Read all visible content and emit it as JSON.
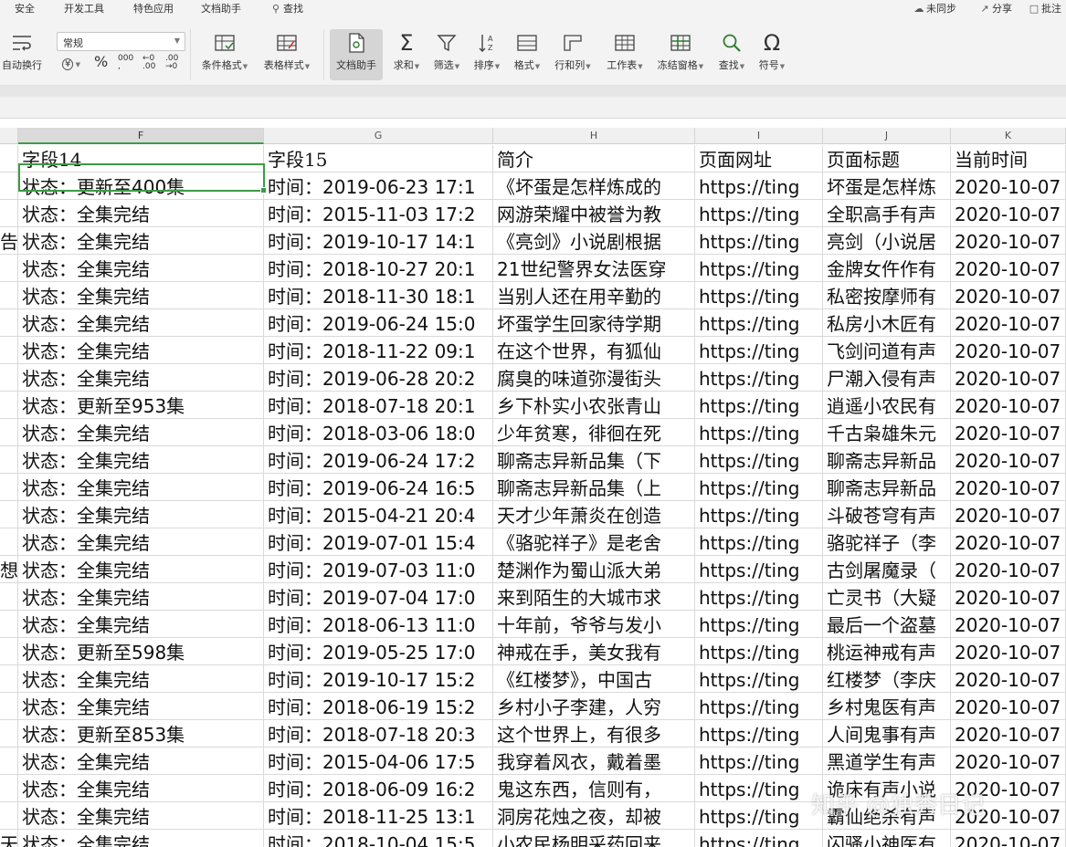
{
  "menu": {
    "left": [
      "安全",
      "开发工具",
      "特色应用",
      "文档助手"
    ],
    "search": "查找",
    "right": [
      "未同步",
      "分享",
      "批注"
    ]
  },
  "ribbon": {
    "wrap_label": "自动换行",
    "format_value": "常规",
    "currency_symbol": "¥",
    "percent_symbol": "%",
    "thousands_symbol": "000",
    "inc_decimal": "←0 .00",
    "dec_decimal": ".00 →0",
    "buttons": [
      {
        "label": "条件格式",
        "icon": "conditional-format-icon"
      },
      {
        "label": "表格样式",
        "icon": "table-style-icon"
      },
      {
        "label": "文档助手",
        "icon": "doc-assistant-icon"
      },
      {
        "label": "求和",
        "icon": "sum-icon"
      },
      {
        "label": "筛选",
        "icon": "filter-icon"
      },
      {
        "label": "排序",
        "icon": "sort-icon"
      },
      {
        "label": "格式",
        "icon": "format-icon"
      },
      {
        "label": "行和列",
        "icon": "rows-cols-icon"
      },
      {
        "label": "工作表",
        "icon": "worksheet-icon"
      },
      {
        "label": "冻结窗格",
        "icon": "freeze-panes-icon"
      },
      {
        "label": "查找",
        "icon": "find-icon"
      },
      {
        "label": "符号",
        "icon": "symbol-icon"
      }
    ]
  },
  "columns": {
    "letters": [
      "F",
      "G",
      "H",
      "I",
      "J",
      "K"
    ],
    "selected": "F"
  },
  "header_row": [
    "",
    "字段14",
    "字段15",
    "简介",
    "页面网址",
    "页面标题",
    "当前时间"
  ],
  "rows": [
    [
      "",
      "状态：更新至400集",
      "时间：2019-06-23 17:1",
      "《坏蛋是怎样炼成的",
      "https://ting",
      "坏蛋是怎样炼",
      "2020-10-07"
    ],
    [
      "",
      "状态：全集完结",
      "时间：2015-11-03 17:2",
      "网游荣耀中被誉为教",
      "https://ting",
      "全职高手有声",
      "2020-10-07"
    ],
    [
      "告",
      "状态：全集完结",
      "时间：2019-10-17 14:1",
      "《亮剑》小说剧根据",
      "https://ting",
      "亮剑（小说居",
      "2020-10-07"
    ],
    [
      "",
      "状态：全集完结",
      "时间：2018-10-27 20:1",
      "21世纪警界女法医穿",
      "https://ting",
      "金牌女仵作有",
      "2020-10-07"
    ],
    [
      "",
      "状态：全集完结",
      "时间：2018-11-30 18:1",
      "当别人还在用辛勤的",
      "https://ting",
      "私密按摩师有",
      "2020-10-07"
    ],
    [
      "",
      "状态：全集完结",
      "时间：2019-06-24 15:0",
      "坏蛋学生回家待学期",
      "https://ting",
      "私房小木匠有",
      "2020-10-07"
    ],
    [
      "",
      "状态：全集完结",
      "时间：2018-11-22 09:1",
      "在这个世界，有狐仙",
      "https://ting",
      "飞剑问道有声",
      "2020-10-07"
    ],
    [
      "",
      "状态：全集完结",
      "时间：2019-06-28 20:2",
      "腐臭的味道弥漫街头",
      "https://ting",
      "尸潮入侵有声",
      "2020-10-07"
    ],
    [
      "",
      "状态：更新至953集",
      "时间：2018-07-18 20:1",
      "乡下朴实小农张青山",
      "https://ting",
      "逍遥小农民有",
      "2020-10-07"
    ],
    [
      "",
      "状态：全集完结",
      "时间：2018-03-06 18:0",
      "少年贫寒，徘徊在死",
      "https://ting",
      "千古枭雄朱元",
      "2020-10-07"
    ],
    [
      "",
      "状态：全集完结",
      "时间：2019-06-24 17:2",
      "聊斋志异新品集（下",
      "https://ting",
      "聊斋志异新品",
      "2020-10-07"
    ],
    [
      "",
      "状态：全集完结",
      "时间：2019-06-24 16:5",
      "聊斋志异新品集（上",
      "https://ting",
      "聊斋志异新品",
      "2020-10-07"
    ],
    [
      "",
      "状态：全集完结",
      "时间：2015-04-21 20:4",
      "天才少年萧炎在创造",
      "https://ting",
      "斗破苍穹有声",
      "2020-10-07"
    ],
    [
      "",
      "状态：全集完结",
      "时间：2019-07-01 15:4",
      "《骆驼祥子》是老舍",
      "https://ting",
      "骆驼祥子（李",
      "2020-10-07"
    ],
    [
      "想",
      "状态：全集完结",
      "时间：2019-07-03 11:0",
      "楚渊作为蜀山派大弟",
      "https://ting",
      "古剑屠魔录（",
      "2020-10-07"
    ],
    [
      "",
      "状态：全集完结",
      "时间：2019-07-04 17:0",
      "来到陌生的大城市求",
      "https://ting",
      "亡灵书（大疑",
      "2020-10-07"
    ],
    [
      "",
      "状态：全集完结",
      "时间：2018-06-13 11:0",
      "十年前，爷爷与发小",
      "https://ting",
      "最后一个盗墓",
      "2020-10-07"
    ],
    [
      "",
      "状态：更新至598集",
      "时间：2019-05-25 17:0",
      "神戒在手，美女我有",
      "https://ting",
      "桃运神戒有声",
      "2020-10-07"
    ],
    [
      "",
      "状态：全集完结",
      "时间：2019-10-17 15:2",
      "《红楼梦》，中国古",
      "https://ting",
      "红楼梦（李庆",
      "2020-10-07"
    ],
    [
      "",
      "状态：全集完结",
      "时间：2018-06-19 15:2",
      "乡村小子李建，人穷",
      "https://ting",
      "乡村鬼医有声",
      "2020-10-07"
    ],
    [
      "",
      "状态：更新至853集",
      "时间：2018-07-18 20:3",
      "这个世界上，有很多",
      "https://ting",
      "人间鬼事有声",
      "2020-10-07"
    ],
    [
      "",
      "状态：全集完结",
      "时间：2015-04-06 17:5",
      "我穿着风衣，戴着墨",
      "https://ting",
      "黑道学生有声",
      "2020-10-07"
    ],
    [
      "",
      "状态：全集完结",
      "时间：2018-06-09 16:2",
      "鬼这东西，信则有，",
      "https://ting",
      "诡床有声小说",
      "2020-10-07"
    ],
    [
      "",
      "状态：全集完结",
      "时间：2018-11-25 13:1",
      "洞房花烛之夜，却被",
      "https://ting",
      "霸仙绝杀有声",
      "2020-10-07"
    ],
    [
      "天目",
      "状态：全集完结",
      "时间：2018-10-04 15:5",
      "小农民杨明采药回来",
      "https://ting",
      "闪骚小神医有",
      "2020-10-07"
    ]
  ],
  "watermark": "知乎 @独秀日记"
}
